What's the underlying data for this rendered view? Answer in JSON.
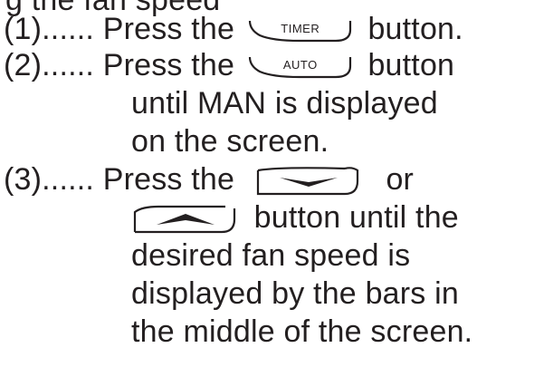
{
  "header": {
    "text": "g the fan speed"
  },
  "steps": [
    {
      "number": "(1)......",
      "before": "Press the",
      "key": "TIMER",
      "after": "button."
    },
    {
      "number": "(2)......",
      "before": "Press the",
      "key": "AUTO",
      "after": "button",
      "continuation": [
        "until MAN is displayed",
        "on the screen."
      ]
    },
    {
      "number": "(3)......",
      "before": "Press the",
      "key_icon": "down-arrow-icon",
      "middle": "or",
      "key2_icon": "up-arrow-icon",
      "after2": "button until the",
      "continuation": [
        "desired fan speed is",
        "displayed by the bars in",
        "the middle of the screen."
      ]
    }
  ]
}
